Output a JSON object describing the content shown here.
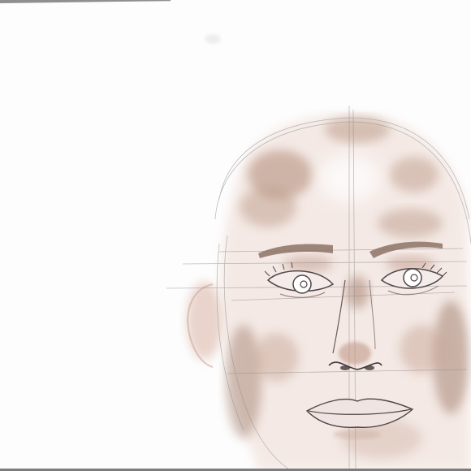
{
  "canvas": {
    "background": "#fdfdfd",
    "subject": "digital-sketch-face",
    "palette": {
      "skin_light": "#f3e6e1",
      "skin_mid": "#d9b4a3",
      "shadow": "#a9826f",
      "brow": "#8c7266",
      "line": "#5a4f4b",
      "lip": "#efe4e2"
    }
  }
}
